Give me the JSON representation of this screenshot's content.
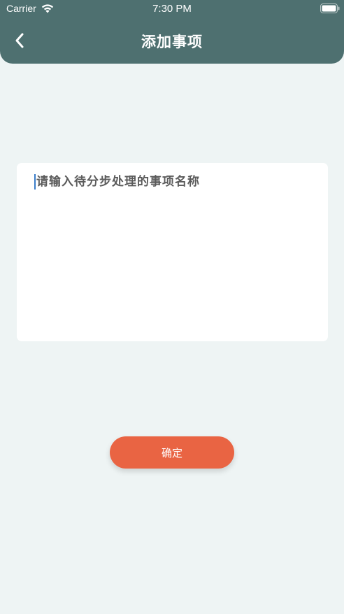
{
  "status_bar": {
    "carrier": "Carrier",
    "time": "7:30 PM",
    "wifi_icon": "wifi-icon",
    "battery_icon": "battery-icon"
  },
  "nav": {
    "back_icon": "chevron-left-icon",
    "title": "添加事项"
  },
  "form": {
    "item_name_value": "",
    "item_name_placeholder": "请输入待分步处理的事项名称"
  },
  "actions": {
    "confirm_label": "确定"
  },
  "colors": {
    "header_bg": "#4e7070",
    "page_bg": "#eef4f4",
    "card_bg": "#ffffff",
    "confirm_bg": "#e96443",
    "caret": "#3a7cc8"
  }
}
